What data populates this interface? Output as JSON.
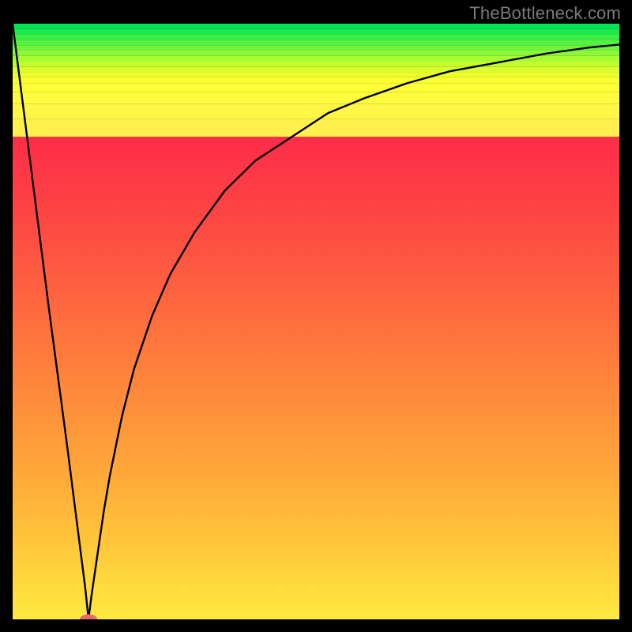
{
  "watermark": "TheBottleneck.com",
  "chart_data": {
    "type": "line",
    "title": "",
    "xlabel": "",
    "ylabel": "",
    "xlim": [
      0,
      100
    ],
    "ylim": [
      0,
      100
    ],
    "grid": false,
    "series": [
      {
        "name": "curve",
        "x": [
          0,
          3,
          6,
          9,
          12,
          12.5,
          13,
          14,
          15,
          16,
          18,
          20,
          23,
          26,
          30,
          35,
          40,
          46,
          52,
          58,
          65,
          72,
          80,
          88,
          95,
          100
        ],
        "y": [
          100,
          76,
          52,
          29,
          5,
          0,
          4,
          11,
          18,
          24,
          34,
          42,
          51,
          58,
          65,
          72,
          77,
          81,
          85,
          87.5,
          90,
          92,
          93.5,
          95,
          96,
          96.5
        ]
      }
    ],
    "marker": {
      "x": 12.5,
      "y": 0,
      "color": "#e46a6e"
    },
    "background_bands": [
      {
        "y0": 99.1,
        "y1": 100,
        "color": "#00e553"
      },
      {
        "y0": 98.2,
        "y1": 99.1,
        "color": "#1fe94d"
      },
      {
        "y0": 97.3,
        "y1": 98.2,
        "color": "#3aee47"
      },
      {
        "y0": 96.4,
        "y1": 97.3,
        "color": "#55f242"
      },
      {
        "y0": 95.5,
        "y1": 96.4,
        "color": "#70f53d"
      },
      {
        "y0": 94.6,
        "y1": 95.5,
        "color": "#8cf838"
      },
      {
        "y0": 93.7,
        "y1": 94.6,
        "color": "#a7fb33"
      },
      {
        "y0": 92.8,
        "y1": 93.7,
        "color": "#c1fc2f"
      },
      {
        "y0": 91.9,
        "y1": 92.8,
        "color": "#d9fd2d"
      },
      {
        "y0": 91.0,
        "y1": 91.9,
        "color": "#edfe2e"
      },
      {
        "y0": 90.0,
        "y1": 91.0,
        "color": "#f9ff31"
      },
      {
        "y0": 88.5,
        "y1": 90.0,
        "color": "#feff37"
      },
      {
        "y0": 86.5,
        "y1": 88.5,
        "color": "#fffb3e"
      },
      {
        "y0": 84.0,
        "y1": 86.5,
        "color": "#fff646"
      },
      {
        "y0": 81.0,
        "y1": 84.0,
        "color": "#fff04d"
      },
      {
        "y0": 0.0,
        "y1": 81.0,
        "gradient": true
      }
    ]
  }
}
